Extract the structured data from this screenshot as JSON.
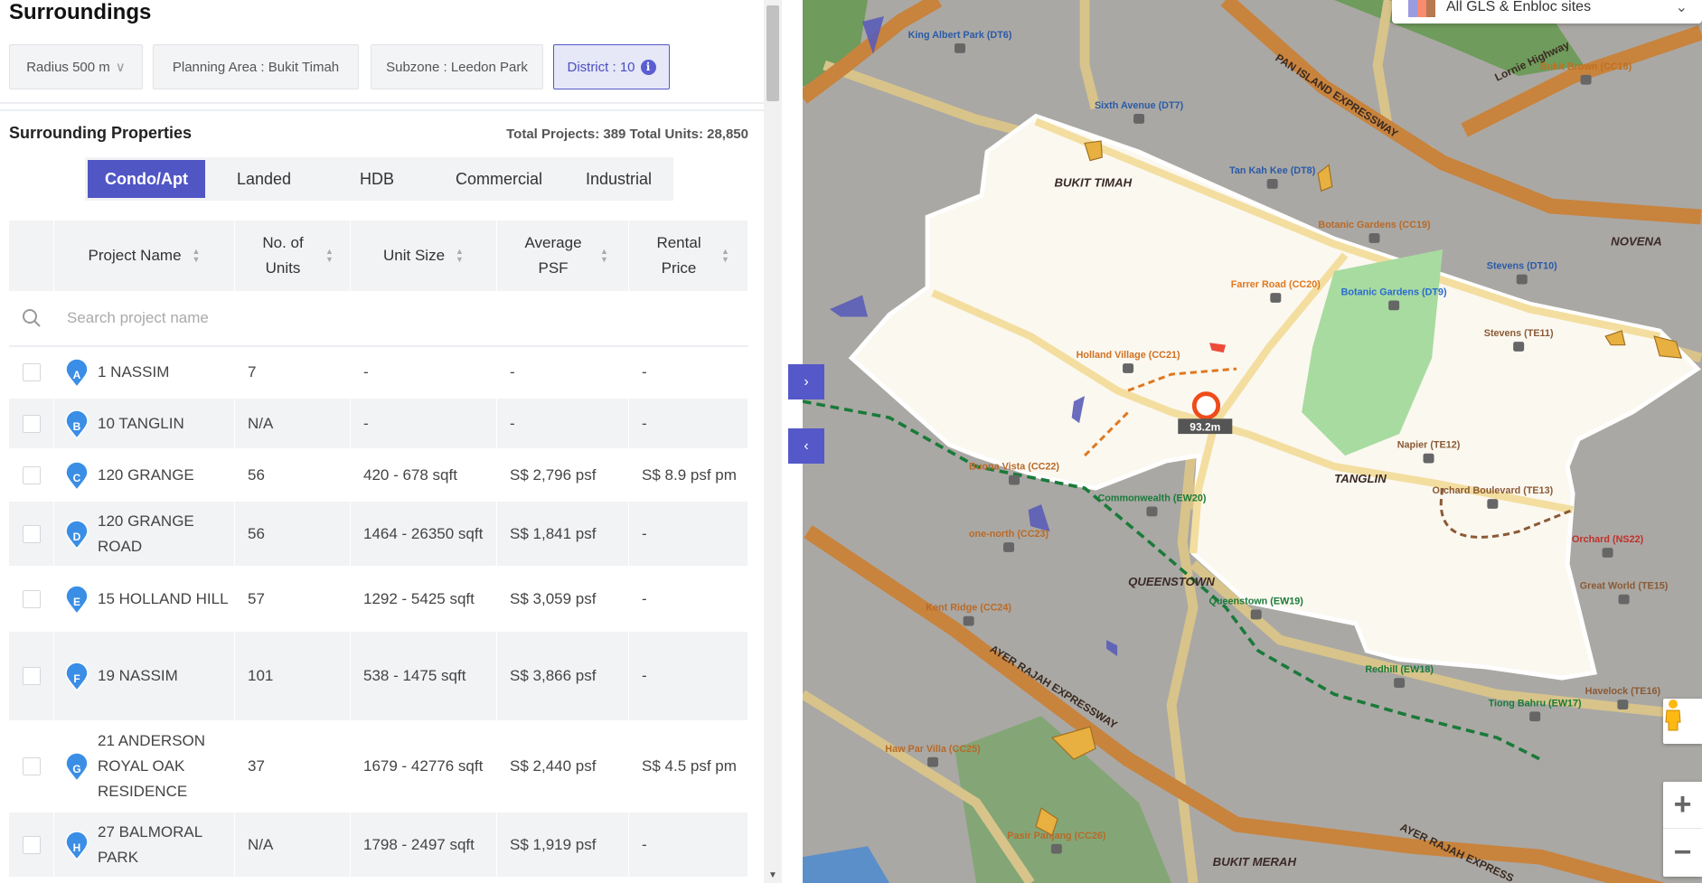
{
  "panel": {
    "title": "Surroundings",
    "filters": {
      "radius": "Radius 500 m",
      "planning_area": "Planning Area : Bukit Timah",
      "subzone": "Subzone : Leedon Park",
      "district": "District : 10"
    },
    "section_title": "Surrounding Properties",
    "totals": "Total Projects: 389 Total Units: 28,850",
    "tabs": [
      {
        "label": "Condo/Apt",
        "active": true
      },
      {
        "label": "Landed"
      },
      {
        "label": "HDB"
      },
      {
        "label": "Commercial"
      },
      {
        "label": "Industrial"
      }
    ],
    "columns": [
      "Project Name",
      "No. of Units",
      "Unit Size",
      "Average PSF",
      "Rental Price"
    ],
    "search_placeholder": "Search project name",
    "rows": [
      {
        "marker": "A",
        "name": "1 NASSIM",
        "units": "7",
        "size": "-",
        "psf": "-",
        "rental": "-"
      },
      {
        "marker": "B",
        "name": "10 TANGLIN",
        "units": "N/A",
        "size": "-",
        "psf": "-",
        "rental": "-"
      },
      {
        "marker": "C",
        "name": "120 GRANGE",
        "units": "56",
        "size": "420 - 678 sqft",
        "psf": "S$ 2,796 psf",
        "rental": "S$ 8.9 psf pm"
      },
      {
        "marker": "D",
        "name": "120 GRANGE ROAD",
        "units": "56",
        "size": "1464 - 26350 sqft",
        "psf": "S$ 1,841 psf",
        "rental": "-"
      },
      {
        "marker": "E",
        "name": "15 HOLLAND HILL",
        "units": "57",
        "size": "1292 - 5425 sqft",
        "psf": "S$ 3,059 psf",
        "rental": "-"
      },
      {
        "marker": "F",
        "name": "19 NASSIM",
        "units": "101",
        "size": "538 - 1475 sqft",
        "psf": "S$ 3,866 psf",
        "rental": "-"
      },
      {
        "marker": "G",
        "name": "21 ANDERSON ROYAL OAK RESIDENCE",
        "units": "37",
        "size": "1679 - 42776 sqft",
        "psf": "S$ 2,440 psf",
        "rental": "S$ 4.5 psf pm"
      },
      {
        "marker": "H",
        "name": "27 BALMORAL PARK",
        "units": "N/A",
        "size": "1798 - 2497 sqft",
        "psf": "S$ 1,919 psf",
        "rental": "-"
      }
    ]
  },
  "map": {
    "layer_select": "All GLS & Enbloc sites",
    "distance_label": "93.2m",
    "areas": [
      "BUKIT TIMAH",
      "TANGLIN",
      "NOVENA",
      "QUEENSTOWN",
      "BUKIT MERAH"
    ],
    "roads": [
      "PAN ISLAND EXPRESSWAY",
      "AYER RAJAH EXPRESSWAY",
      "Lornie Highway",
      "AYER RAJAH EXPRESS"
    ],
    "stations": [
      "King Albert Park (DT6)",
      "Sixth Avenue (DT7)",
      "Tan Kah Kee (DT8)",
      "Botanic Gardens (CC19)",
      "Botanic Gardens (DT9)",
      "Farrer Road (CC20)",
      "Holland Village (CC21)",
      "Stevens (DT10)",
      "Stevens (TE11)",
      "Napier (TE12)",
      "Orchard Boulevard (TE13)",
      "Buona Vista (CC22)",
      "one-north (CC23)",
      "Commonwealth (EW20)",
      "Queenstown (EW19)",
      "Kent Ridge (CC24)",
      "Haw Par Villa (CC25)",
      "Pasir Panjang (CC26)",
      "Bukit Brown (CC18)",
      "Redhill (EW18)",
      "Tiong Bahru (EW17)",
      "Havelock (TE16)",
      "Orchard (NS22)",
      "Great World (TE15)"
    ],
    "colors": {
      "district": "#fbf8f0",
      "expressway": "#c8833d",
      "major_road": "#d8c48a",
      "park": "#7aa56b",
      "water": "#5b8fc9",
      "accent": "#5558c8",
      "pin": "#3a8ee6"
    }
  }
}
